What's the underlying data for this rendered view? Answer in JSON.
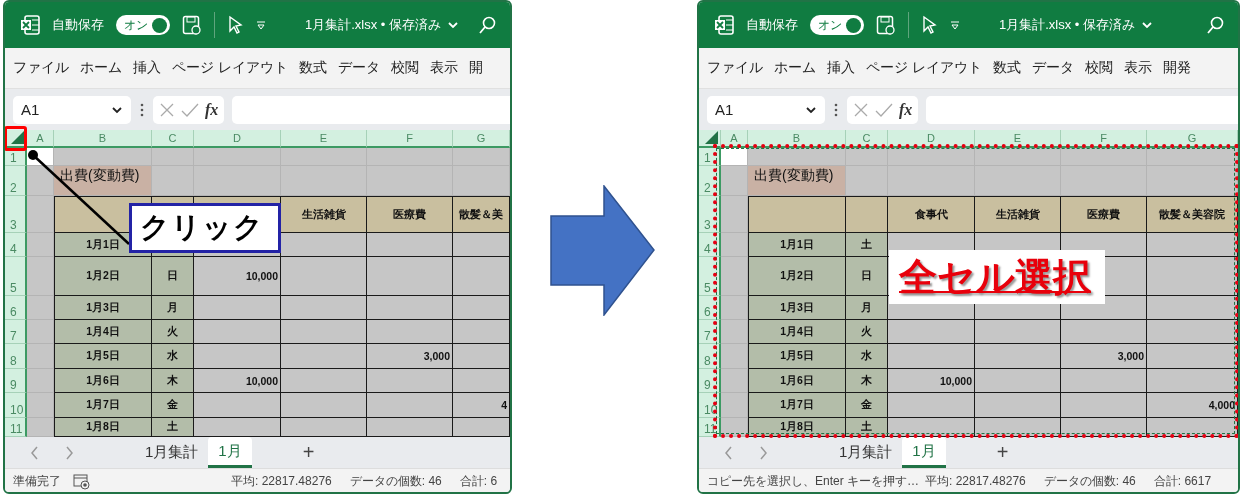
{
  "panels": [
    {
      "autosave_label": "自動保存",
      "autosave_toggle": {
        "label": "オン",
        "on": true
      },
      "file_title": "1月集計.xlsx • 保存済み",
      "menu": [
        "ファイル",
        "ホーム",
        "挿入",
        "ページ レイアウト",
        "数式",
        "データ",
        "校閲",
        "表示",
        "開"
      ],
      "name_box": "A1",
      "function_label": "fx",
      "column_headers": [
        "A",
        "B",
        "C",
        "D",
        "E",
        "F",
        "G"
      ],
      "row_headers": [
        "1",
        "2",
        "3",
        "4",
        "5",
        "6",
        "7",
        "8",
        "9",
        "10",
        "11"
      ],
      "title_cell": "出費(変動費)",
      "table_header": {
        "E": "生活雑貨",
        "F": "医療費",
        "G": "散髪＆美"
      },
      "rows": [
        {
          "date": "1月1日"
        },
        {
          "date": "1月2日",
          "weekday": "日",
          "D": "10,000"
        },
        {
          "date": "1月3日",
          "weekday": "月"
        },
        {
          "date": "1月4日",
          "weekday": "火"
        },
        {
          "date": "1月5日",
          "weekday": "水",
          "F": "3,000"
        },
        {
          "date": "1月6日",
          "weekday": "木",
          "D": "10,000"
        },
        {
          "date": "1月7日",
          "weekday": "金",
          "G": "4"
        },
        {
          "date": "1月8日",
          "weekday": "土"
        }
      ],
      "sheet_tabs": [
        {
          "label": "1月集計",
          "selected": false
        },
        {
          "label": "1月",
          "selected": true
        }
      ],
      "add_sheet": "+",
      "status_message": "準備完了",
      "macro_recording_icon": true,
      "status_stats": [
        "平均: 22817.48276",
        "データの個数: 46",
        "合計: 6"
      ],
      "annotation": {
        "kind": "corner-highlight"
      },
      "callout": {
        "kind": "box",
        "text": "クリック"
      }
    },
    {
      "autosave_label": "自動保存",
      "autosave_toggle": {
        "label": "オン",
        "on": true
      },
      "file_title": "1月集計.xlsx • 保存済み",
      "menu": [
        "ファイル",
        "ホーム",
        "挿入",
        "ページ レイアウト",
        "数式",
        "データ",
        "校閲",
        "表示",
        "開発"
      ],
      "name_box": "A1",
      "function_label": "fx",
      "column_headers": [
        "A",
        "B",
        "C",
        "D",
        "E",
        "F",
        "G"
      ],
      "row_headers": [
        "1",
        "2",
        "3",
        "4",
        "5",
        "6",
        "7",
        "8",
        "9",
        "10",
        "11"
      ],
      "title_cell": "出費(変動費)",
      "table_header": {
        "D": "食事代",
        "E": "生活雑貨",
        "F": "医療費",
        "G": "散髪＆美容院"
      },
      "rows": [
        {
          "date": "1月1日",
          "weekday": "土"
        },
        {
          "date": "1月2日",
          "weekday": "日"
        },
        {
          "date": "1月3日",
          "weekday": "月"
        },
        {
          "date": "1月4日",
          "weekday": "火"
        },
        {
          "date": "1月5日",
          "weekday": "水",
          "F": "3,000"
        },
        {
          "date": "1月6日",
          "weekday": "木",
          "D": "10,000"
        },
        {
          "date": "1月7日",
          "weekday": "金",
          "G": "4,000"
        },
        {
          "date": "1月8日",
          "weekday": "土"
        }
      ],
      "sheet_tabs": [
        {
          "label": "1月集計",
          "selected": false
        },
        {
          "label": "1月",
          "selected": true
        }
      ],
      "add_sheet": "+",
      "status_message": "コピー先を選択し、Enter キーを押す…",
      "status_stats": [
        "平均: 22817.48276",
        "データの個数: 46",
        "合計: 6617"
      ],
      "annotation": {
        "kind": "dotted-frame"
      },
      "callout": {
        "kind": "label",
        "text": "全セル選択"
      }
    }
  ]
}
